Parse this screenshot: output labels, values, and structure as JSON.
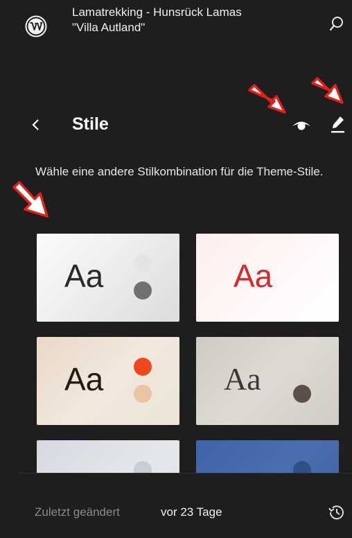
{
  "site": {
    "title_line1": "Lamatrekking - Hunsrück Lamas",
    "title_line2": "\"Villa Autland\"",
    "logo_icon": "wordpress-logo-icon",
    "search_icon": "search-icon"
  },
  "header": {
    "back_icon": "chevron-left-icon",
    "title": "Stile",
    "preview_icon": "eye-icon",
    "edit_icon": "pencil-icon"
  },
  "description": "Wähle eine andere Stilkombination für die Theme-Stile.",
  "variations": [
    {
      "label": "Aa",
      "text_color": "#2a2a2a",
      "dot_colors": [
        "#e4e4e4",
        "#707070"
      ]
    },
    {
      "label": "Aa",
      "text_color": "#d42a2a",
      "dot_colors": []
    },
    {
      "label": "Aa",
      "text_color": "#231a14",
      "dot_colors": [
        "#f0471c",
        "#ebc4a6"
      ]
    },
    {
      "label": "Aa",
      "text_color": "#3a3a3a",
      "dot_colors": [
        "#dcd9d2",
        "#5c5049"
      ]
    },
    {
      "label": "",
      "text_color": "#555555",
      "dot_colors": [
        "#c8ced4"
      ]
    },
    {
      "label": "",
      "text_color": "#e0e8f5",
      "dot_colors": [
        "#2f4f88"
      ]
    }
  ],
  "footer": {
    "label": "Zuletzt geändert",
    "value": "vor 23 Tage",
    "history_icon": "history-icon"
  },
  "annotations": [
    "red-arrow",
    "red-arrow",
    "red-arrow"
  ]
}
